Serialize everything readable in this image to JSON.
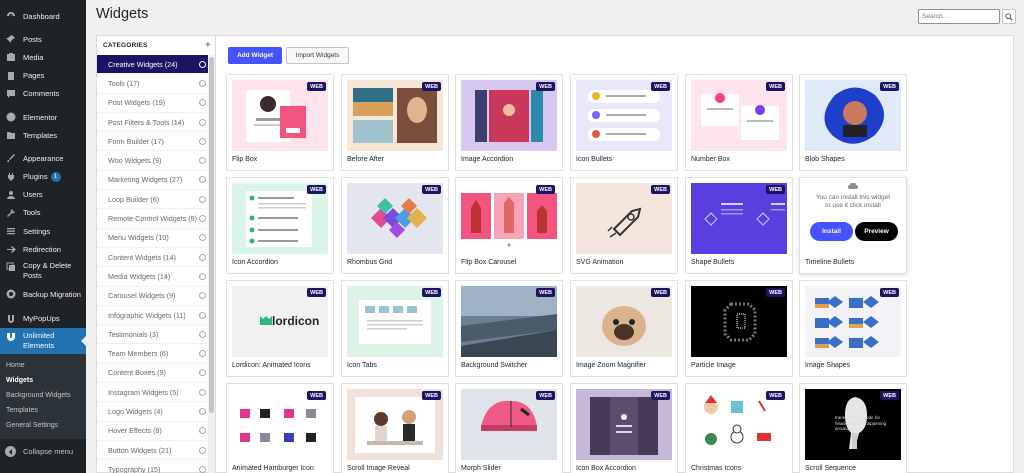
{
  "sidebar": {
    "items": [
      {
        "label": "Dashboard",
        "icon": "dashboard-icon"
      },
      {
        "label": "Posts",
        "icon": "pin-icon"
      },
      {
        "label": "Media",
        "icon": "media-icon"
      },
      {
        "label": "Pages",
        "icon": "page-icon"
      },
      {
        "label": "Comments",
        "icon": "comment-icon"
      },
      {
        "label": "Elementor",
        "icon": "elementor-icon"
      },
      {
        "label": "Templates",
        "icon": "folder-icon"
      },
      {
        "label": "Appearance",
        "icon": "brush-icon"
      },
      {
        "label": "Plugins",
        "icon": "plugin-icon",
        "badge": "1"
      },
      {
        "label": "Users",
        "icon": "user-icon"
      },
      {
        "label": "Tools",
        "icon": "wrench-icon"
      },
      {
        "label": "Settings",
        "icon": "settings-icon"
      },
      {
        "label": "Redirection",
        "icon": "redirect-icon"
      },
      {
        "label": "Copy & Delete Posts",
        "icon": "copy-icon"
      },
      {
        "label": "Backup Migration",
        "icon": "backup-icon"
      },
      {
        "label": "MyPopUps",
        "icon": "popup-icon"
      },
      {
        "label": "Unlimited Elements",
        "icon": "unlimited-icon"
      }
    ],
    "submenu": [
      "Home",
      "Widgets",
      "Background Widgets",
      "Templates",
      "General Settings"
    ],
    "collapse_label": "Collapse menu"
  },
  "header": {
    "title": "Widgets",
    "search_placeholder": "Search..."
  },
  "categories": {
    "heading": "CATEGORIES",
    "add_symbol": "+",
    "items": [
      "Creative Widgets (24)",
      "Tools (17)",
      "Post Widgets (19)",
      "Post Filters & Tools (14)",
      "Form Builder (17)",
      "Woo Widgets (9)",
      "Marketing Widgets (27)",
      "Loop Builder (6)",
      "Remote Control Widgets (9)",
      "Menu Widgets (10)",
      "Content Widgets (14)",
      "Media Widgets (14)",
      "Carousel Widgets (9)",
      "Infographic Widgets (11)",
      "Testimonials (3)",
      "Team Members (6)",
      "Content Boxes (9)",
      "Instagram Widgets (5)",
      "Logo Widgets (4)",
      "Hover Effects (8)",
      "Button Widgets (21)",
      "Typography (15)"
    ]
  },
  "toolbar": {
    "add_label": "Add Widget",
    "import_label": "Import Widgets"
  },
  "web_tag": "WEB",
  "widgets": [
    {
      "name": "Flip Box",
      "thumb": "flipbox"
    },
    {
      "name": "Before After",
      "thumb": "beforeafter"
    },
    {
      "name": "Image Accordion",
      "thumb": "imgaccordion"
    },
    {
      "name": "Icon Bullets",
      "thumb": "iconbullets"
    },
    {
      "name": "Number Box",
      "thumb": "numberbox"
    },
    {
      "name": "Blob Shapes",
      "thumb": "blob"
    },
    {
      "name": "Icon Accordion",
      "thumb": "iconaccordion"
    },
    {
      "name": "Rhombus Grid",
      "thumb": "rhombus"
    },
    {
      "name": "Flip Box Carousel",
      "thumb": "flipcarousel"
    },
    {
      "name": "SVG Animation",
      "thumb": "svganim"
    },
    {
      "name": "Shape Bullets",
      "thumb": "shapebullets"
    },
    {
      "name": "Timeline Bullets",
      "thumb": "timeline"
    },
    {
      "name": "Lordicon: Animated Icons",
      "thumb": "lordicon"
    },
    {
      "name": "Icon Tabs",
      "thumb": "icontabs"
    },
    {
      "name": "Background Switcher",
      "thumb": "bgswitch"
    },
    {
      "name": "Image Zoom Magnifier",
      "thumb": "zoom"
    },
    {
      "name": "Particle Image",
      "thumb": "particle"
    },
    {
      "name": "Image Shapes",
      "thumb": "imgshapes"
    },
    {
      "name": "Animated Hamburger Icon",
      "thumb": "hamburger"
    },
    {
      "name": "Scroll Image Reveal",
      "thumb": "scrollreveal"
    },
    {
      "name": "Morph Slider",
      "thumb": "morph"
    },
    {
      "name": "Icon Box Accordion",
      "thumb": "iconboxacc"
    },
    {
      "name": "Christmas Icons",
      "thumb": "christmas"
    },
    {
      "name": "Scroll Sequence",
      "thumb": "scrollseq"
    }
  ],
  "install_card": {
    "line1": "You can install this widget",
    "line2": "to use it click install",
    "install_label": "Install",
    "preview_label": "Preview"
  },
  "lordicon_text": "lordicon",
  "scroll_seq_text": "transparency mode for hearing what's happening around you"
}
